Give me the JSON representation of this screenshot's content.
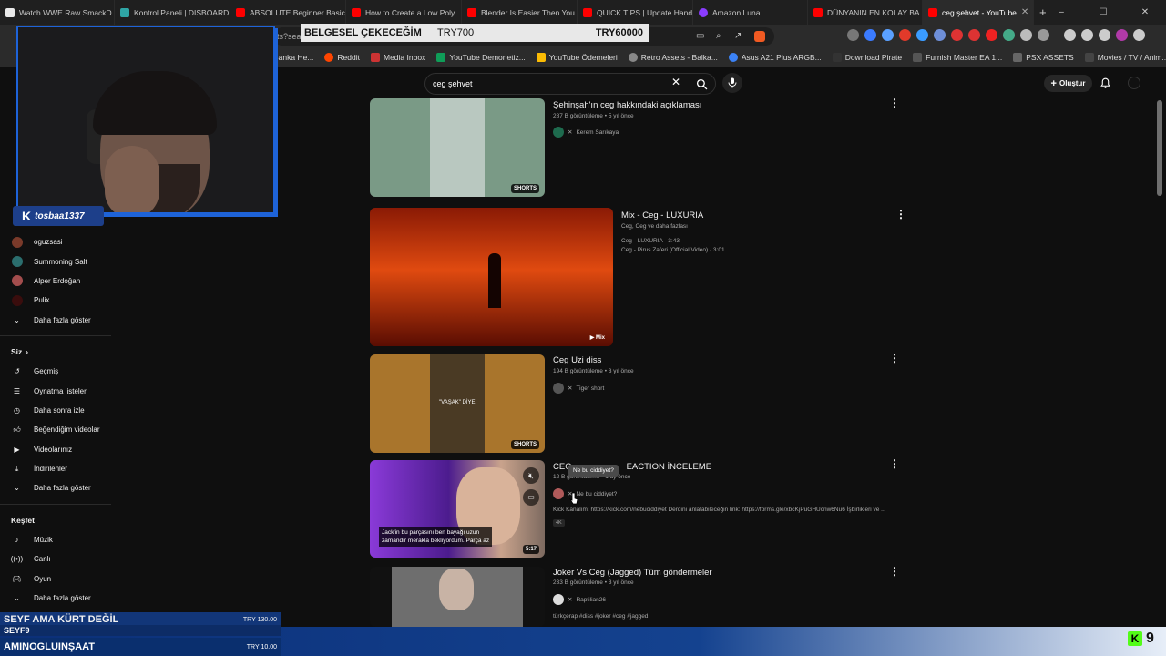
{
  "tabs": [
    {
      "label": "Watch WWE Raw SmackD",
      "color": "#e8e8e8"
    },
    {
      "label": "Kontrol Paneli | DISBOARD",
      "color": "#2fa5a5"
    },
    {
      "label": "ABSOLUTE Beginner Basics",
      "color": "#ff0000"
    },
    {
      "label": "How to Create a Low Poly",
      "color": "#ff0000"
    },
    {
      "label": "Blender Is Easier Then You",
      "color": "#ff0000"
    },
    {
      "label": "QUICK TIPS | Update Hand",
      "color": "#ff0000"
    },
    {
      "label": "Amazon Luna",
      "color": "#8a3cff"
    },
    {
      "label": "DÜNYANIN EN KOLAY BA",
      "color": "#ff0000"
    },
    {
      "label": "ceg şehvet - YouTube",
      "color": "#ff0000",
      "active": true
    }
  ],
  "window_controls": {
    "minimize": "–",
    "maximize": "☐",
    "close": "✕"
  },
  "address": {
    "url_fragment": "lts?sea"
  },
  "bookmarks": [
    "Banka He...",
    "Reddit",
    "Media Inbox",
    "YouTube Demonetiz...",
    "YouTube Ödemeleri",
    "Retro Assets - Balka...",
    "Asus A21 Plus ARGB...",
    "Download Pirate",
    "Furnish Master EA 1...",
    "PSX ASSETS",
    "Movies / TV / Anim..."
  ],
  "overlay": {
    "title": "BELGESEL ÇEKECEĞİM",
    "current": "TRY700",
    "goal": "TRY60000"
  },
  "webcam": {
    "username": "tosbaa1337"
  },
  "search": {
    "query": "ceg şehvet"
  },
  "header": {
    "create_label": "Oluştur"
  },
  "sidebar": {
    "subscriptions": [
      {
        "label": "oguzsasi",
        "color": "#7a3a2a"
      },
      {
        "label": "Summoning Salt",
        "color": "#2b6e6e"
      },
      {
        "label": "Alper Erdoğan",
        "color": "#a34d4d"
      },
      {
        "label": "Pulix",
        "color": "#3a0d0d"
      }
    ],
    "subs_more": "Daha fazla göster",
    "you_heading": "Siz",
    "you_items": [
      {
        "label": "Geçmiş",
        "icon": "history-icon"
      },
      {
        "label": "Oynatma listeleri",
        "icon": "playlist-icon"
      },
      {
        "label": "Daha sonra izle",
        "icon": "clock-icon"
      },
      {
        "label": "Beğendiğim videolar",
        "icon": "thumbs-up-icon"
      },
      {
        "label": "Videolarınız",
        "icon": "video-icon"
      },
      {
        "label": "İndirilenler",
        "icon": "download-icon"
      }
    ],
    "you_more": "Daha fazla göster",
    "explore_heading": "Keşfet",
    "explore_items": [
      {
        "label": "Müzik",
        "icon": "music-icon"
      },
      {
        "label": "Canlı",
        "icon": "live-icon"
      },
      {
        "label": "Oyun",
        "icon": "gaming-icon"
      }
    ],
    "explore_more": "Daha fazla göster"
  },
  "results": [
    {
      "title": "Şehinşah'ın ceg hakkındaki açıklaması",
      "meta": "287 B görüntüleme • 5 yıl önce",
      "channel": "Kerem Sarıkaya",
      "badge": "SHORTS"
    },
    {
      "title": "Mix - Ceg - LUXURIA",
      "meta": "Ceg, Ceg ve daha fazlası",
      "line1": "Ceg - LUXURIA · 3:43",
      "line2": "Ceg - Pirus Zaferi (Official Video) · 3:01",
      "badge": "Mix"
    },
    {
      "title": "Ceg Uzi diss",
      "meta": "194 B görüntüleme • 3 yıl önce",
      "channel": "Tiger short",
      "badge": "SHORTS",
      "thumb_caption": "\"VAŞAK\" DİYE"
    },
    {
      "title": "CEG",
      "title_suffix": "EACTION İNCELEME",
      "meta": "12 B görüntüleme • 1 ay önce",
      "channel": "Ne bu ciddiyet?",
      "tooltip": "Ne bu ciddiyet?",
      "desc": "Kick Kanalım: https://kick.com/nebuciddiyet Derdini anlatabileceğin link: https://forms.gle/xbcKjPuGHUcnw6Nu6 İşbirlikleri ve ...",
      "chip": "4K",
      "badge": "5:17",
      "subtitle_line1": "Jack'in bu parçasını ben bayağı uzun",
      "subtitle_line2": "zamandır merakla bekliyordum. Parça az"
    },
    {
      "title": "Joker Vs Ceg (Jagged) Tüm göndermeler",
      "meta": "233 B görüntüleme • 3 yıl önce",
      "channel": "Raptilian26",
      "desc": "türkçerap #diss #joker #ceg #jagged."
    }
  ],
  "donors": [
    {
      "name": "SEYF AMA KÜRT DEĞİL",
      "amount": "TRY 130.00"
    },
    {
      "name": "SEYF9",
      "amount": ""
    },
    {
      "name": "AMINOGLUINŞAAT",
      "amount": "TRY 10.00"
    }
  ],
  "kick": {
    "viewers": "9"
  }
}
